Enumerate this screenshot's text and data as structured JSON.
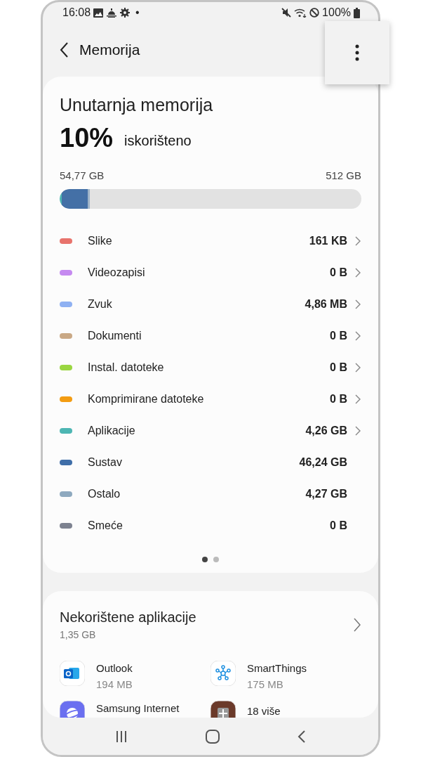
{
  "status_bar": {
    "time": "16:08",
    "dot": "•",
    "battery": "100%"
  },
  "header": {
    "title": "Memorija"
  },
  "storage": {
    "title": "Unutarnja memorija",
    "percent": "10%",
    "percent_label": "iskorišteno",
    "used": "54,77 GB",
    "total": "512 GB",
    "level": 0.1
  },
  "categories": [
    {
      "name": "Slike",
      "size": "161 KB",
      "color": "#e8736c",
      "chevron": true
    },
    {
      "name": "Videozapisi",
      "size": "0 B",
      "color": "#c58af0",
      "chevron": true
    },
    {
      "name": "Zvuk",
      "size": "4,86 MB",
      "color": "#8fb1f2",
      "chevron": true
    },
    {
      "name": "Dokumenti",
      "size": "0 B",
      "color": "#c9a885",
      "chevron": true
    },
    {
      "name": "Instal. datoteke",
      "size": "0 B",
      "color": "#9ad641",
      "chevron": true
    },
    {
      "name": "Komprimirane datoteke",
      "size": "0 B",
      "color": "#f39c12",
      "chevron": true
    },
    {
      "name": "Aplikacije",
      "size": "4,26 GB",
      "color": "#4db6b3",
      "chevron": true
    },
    {
      "name": "Sustav",
      "size": "46,24 GB",
      "color": "#3f6ea8",
      "chevron": false
    },
    {
      "name": "Ostalo",
      "size": "4,27 GB",
      "color": "#8ea9bf",
      "chevron": false
    },
    {
      "name": "Smeće",
      "size": "0 B",
      "color": "#7d8290",
      "chevron": false
    }
  ],
  "pages": [
    {
      "selected": true
    },
    {
      "selected": false
    }
  ],
  "unused_apps": {
    "title": "Nekorištene aplikacije",
    "size": "1,35 GB",
    "apps": [
      {
        "kind": "outlook",
        "name": "Outlook",
        "size": "194 MB"
      },
      {
        "kind": "smartthings",
        "name": "SmartThings",
        "size": "175 MB"
      },
      {
        "kind": "internet",
        "name": "Samsung Internet"
      },
      {
        "kind": "more",
        "name": "18 više"
      }
    ]
  }
}
